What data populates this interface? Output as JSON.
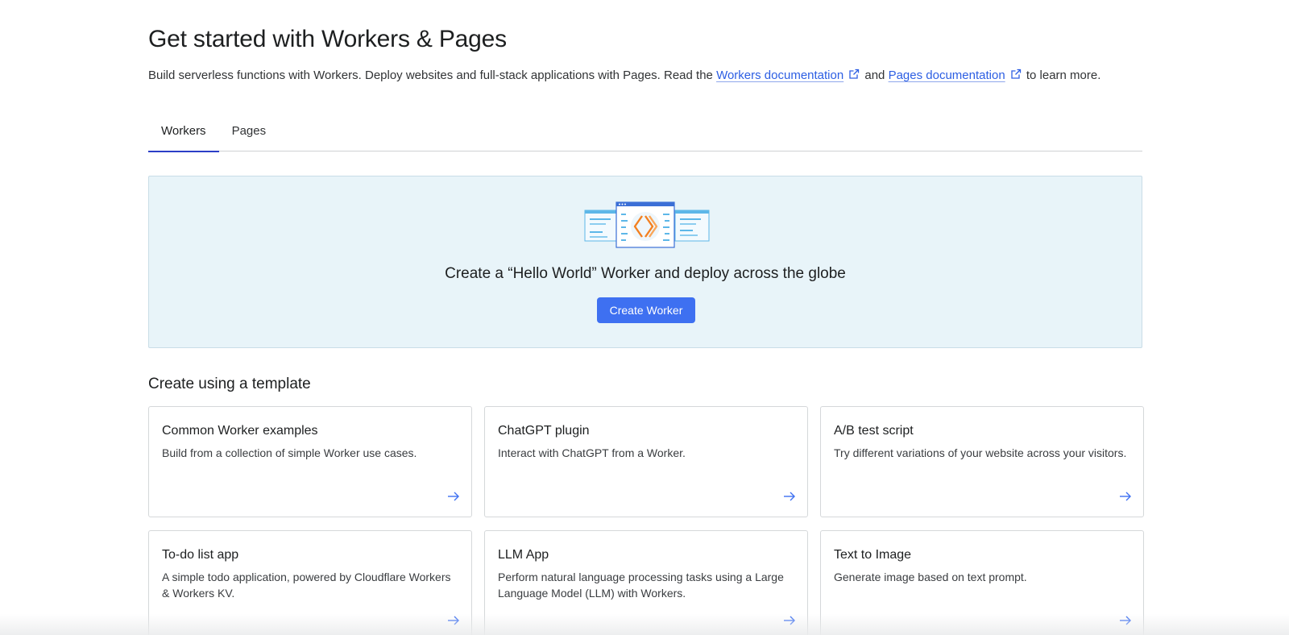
{
  "header": {
    "title": "Get started with Workers & Pages",
    "intro_prefix": "Build serverless functions with Workers. Deploy websites and full-stack applications with Pages. Read the ",
    "workers_doc_link": "Workers documentation",
    "intro_middle": " and ",
    "pages_doc_link": "Pages documentation",
    "intro_suffix": " to learn more."
  },
  "tabs": [
    {
      "label": "Workers",
      "active": true
    },
    {
      "label": "Pages",
      "active": false
    }
  ],
  "hero": {
    "text": "Create a “Hello World” Worker and deploy across the globe",
    "button_label": "Create Worker",
    "illustration_icon": "worker-illustration-icon"
  },
  "templates": {
    "heading": "Create using a template",
    "cards": [
      {
        "title": "Common Worker examples",
        "description": "Build from a collection of simple Worker use cases."
      },
      {
        "title": "ChatGPT plugin",
        "description": "Interact with ChatGPT from a Worker."
      },
      {
        "title": "A/B test script",
        "description": "Try different variations of your website across your visitors."
      },
      {
        "title": "To-do list app",
        "description": "A simple todo application, powered by Cloudflare Workers & Workers KV."
      },
      {
        "title": "LLM App",
        "description": "Perform natural language processing tasks using a Large Language Model (LLM) with Workers."
      },
      {
        "title": "Text to Image",
        "description": "Generate image based on text prompt."
      }
    ]
  },
  "colors": {
    "link": "#2c5ee3",
    "primary_button": "#3e70f1",
    "hero_background": "#e8f4f9",
    "active_tab_underline": "#2c3fc7",
    "illustration_accent": "#f38020"
  }
}
